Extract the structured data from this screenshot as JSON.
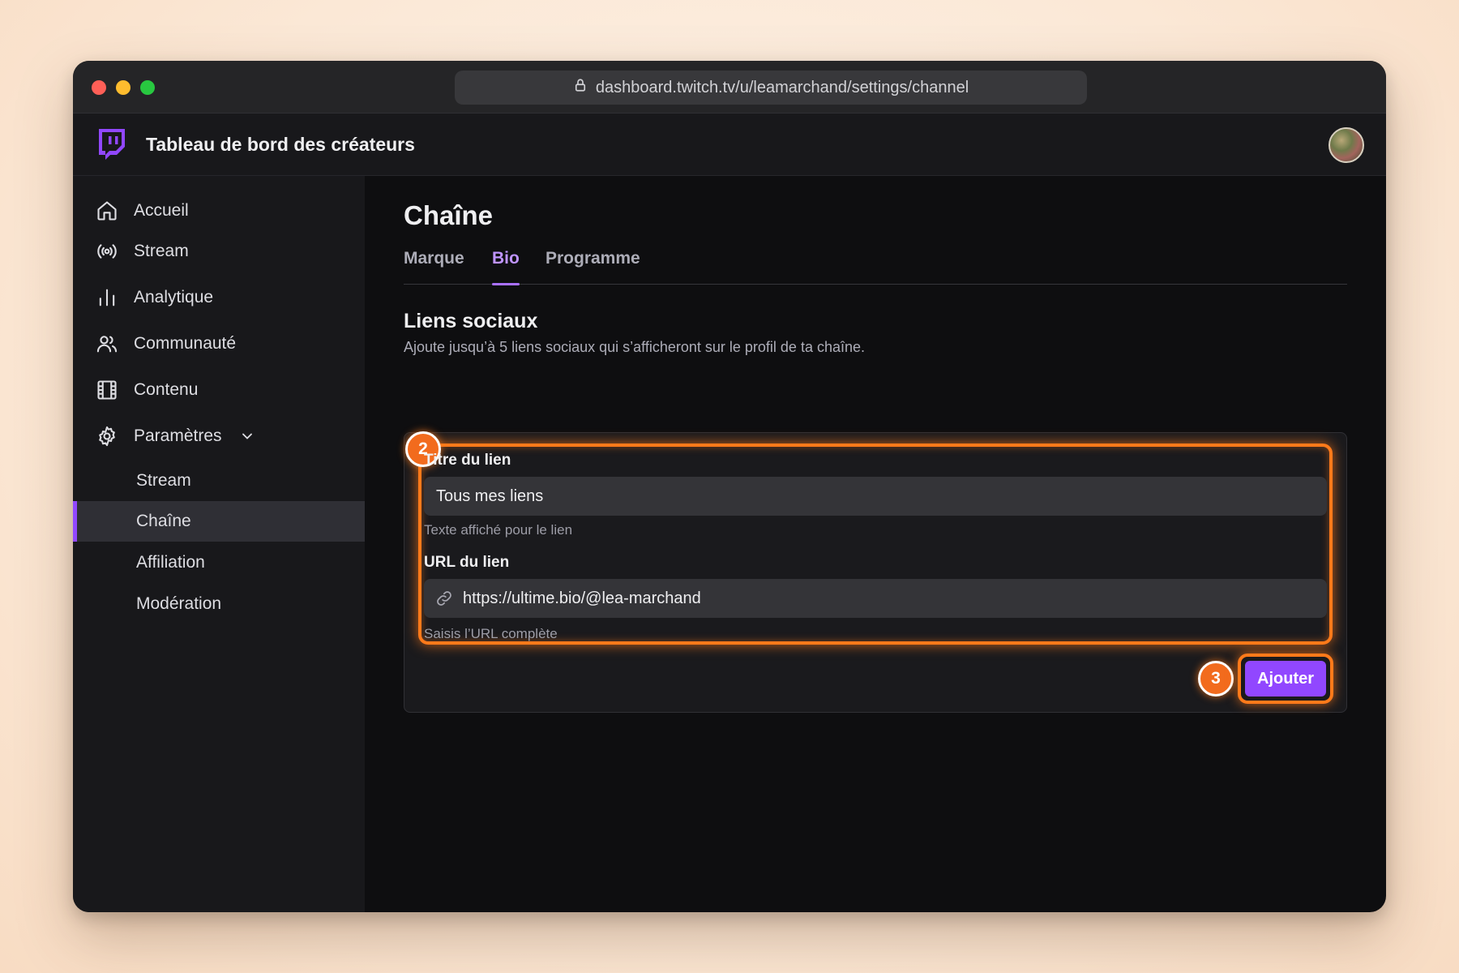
{
  "browser": {
    "url": "dashboard.twitch.tv/u/leamarchand/settings/channel"
  },
  "app": {
    "title": "Tableau de bord des créateurs",
    "accent_color": "#9147ff",
    "highlight_color": "#ff7a1a"
  },
  "sidebar": {
    "items": [
      {
        "label": "Accueil",
        "icon": "home-icon"
      },
      {
        "label": "Stream",
        "icon": "broadcast-icon"
      },
      {
        "label": "Analytique",
        "icon": "bar-chart-icon"
      },
      {
        "label": "Communauté",
        "icon": "users-icon"
      },
      {
        "label": "Contenu",
        "icon": "film-icon"
      },
      {
        "label": "Paramètres",
        "icon": "gear-icon",
        "expanded": true
      }
    ],
    "sub_items": [
      {
        "label": "Stream"
      },
      {
        "label": "Chaîne",
        "active": true
      },
      {
        "label": "Affiliation"
      },
      {
        "label": "Modération"
      }
    ]
  },
  "main": {
    "title": "Chaîne",
    "tabs": [
      {
        "label": "Marque"
      },
      {
        "label": "Bio",
        "active": true
      },
      {
        "label": "Programme"
      }
    ],
    "section": {
      "title": "Liens sociaux",
      "description": "Ajoute jusqu’à 5 liens sociaux qui s’afficheront sur le profil de ta chaîne."
    },
    "form": {
      "title_label": "Titre du lien",
      "title_value": "Tous mes liens",
      "title_help": "Texte affiché pour le lien",
      "url_label": "URL du lien",
      "url_value": "https://ultime.bio/@lea-marchand",
      "url_help": "Saisis l’URL complète",
      "submit_label": "Ajouter"
    },
    "annotations": {
      "step_fields": "2",
      "step_button": "3"
    }
  }
}
